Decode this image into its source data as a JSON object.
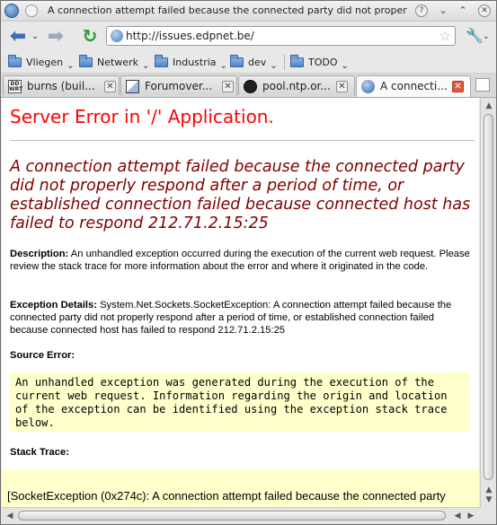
{
  "window": {
    "title": "A connection attempt failed because the connected party did not properly respo...",
    "buttons": {
      "help": "?",
      "minimize": "⌄",
      "maximize": "⌃",
      "close": "✕"
    }
  },
  "navigation": {
    "url": "http://issues.edpnet.be/",
    "back_icon": "back-arrow-icon",
    "forward_icon": "forward-arrow-icon",
    "reload_icon": "reload-icon",
    "tools_icon": "wrench-icon"
  },
  "bookmarks": {
    "items": [
      {
        "label": "Vliegen"
      },
      {
        "label": "Netwerk"
      },
      {
        "label": "Industria"
      },
      {
        "label": "dev"
      },
      {
        "label": "TODO"
      }
    ]
  },
  "tabs": [
    {
      "label": "burns (buil...",
      "icon": "dwrt-icon",
      "active": false
    },
    {
      "label": "Forumover...",
      "icon": "forum-icon",
      "active": false
    },
    {
      "label": "pool.ntp.or...",
      "icon": "clock-icon",
      "active": false
    },
    {
      "label": "A connecti...",
      "icon": "globe-icon",
      "active": true
    }
  ],
  "page": {
    "heading": "Server Error in '/' Application.",
    "message": "A connection attempt failed because the connected party did not properly respond after a period of time, or established connection failed because connected host has failed to respond 212.71.2.15:25",
    "description_label": "Description:",
    "description_text": " An unhandled exception occurred during the execution of the current web request. Please review the stack trace for more information about the error and where it originated in the code.",
    "exception_label": "Exception Details:",
    "exception_text": " System.Net.Sockets.SocketException: A connection attempt failed because the connected party did not properly respond after a period of time, or established connection failed because connected host has failed to respond 212.71.2.15:25",
    "source_error_label": "Source Error:",
    "source_error_text": "An unhandled exception was generated during the execution of the current web request. Information regarding the origin and location of the exception can be identified using the exception stack trace below.",
    "stack_trace_label": "Stack Trace:",
    "stack_trace_text": "[SocketException (0x274c): A connection attempt failed because the connected party"
  },
  "colors": {
    "heading": "#ff0000",
    "message": "#800000",
    "code_background": "#ffffcc"
  }
}
